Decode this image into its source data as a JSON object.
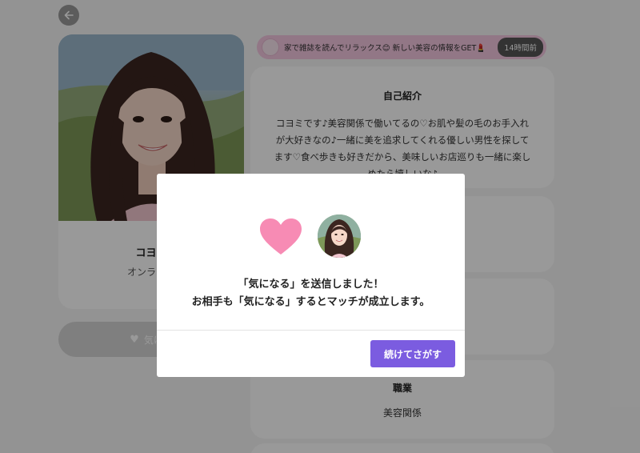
{
  "header": {
    "back_icon": "arrow-left-icon"
  },
  "profile": {
    "name": "コヨミ",
    "status": "オンライン",
    "photo_icon": "profile-photo"
  },
  "like_button": {
    "label": "気にな",
    "icon": "heart-icon"
  },
  "tweet": {
    "text": "家で雑誌を読んでリラックス😊 新しい美容の情報をGET💄",
    "time": "14時間前"
  },
  "sections": {
    "intro": {
      "title": "自己紹介",
      "body": "コヨミです♪美容関係で働いてるの♡お肌や髪の毛のお手入れが大好きなの♪一緒に美を追求してくれる優しい男性を探してます♡食べ歩きも好きだから、美味しいお店巡りも一緒に楽しめたら嬉しいな♪"
    },
    "job": {
      "title": "職業",
      "value": "美容関係"
    }
  },
  "modal": {
    "heart_icon": "heart-icon",
    "line1": "「気になる」を送信しました！",
    "line2": "お相手も「気になる」するとマッチが成立します。",
    "continue_label": "続けてさがす"
  },
  "colors": {
    "accent": "#7b5ce0",
    "heart": "#f78bb4",
    "tweet_bg": "#f4c6e0",
    "overlay": "rgba(0,0,0,0.4)"
  }
}
